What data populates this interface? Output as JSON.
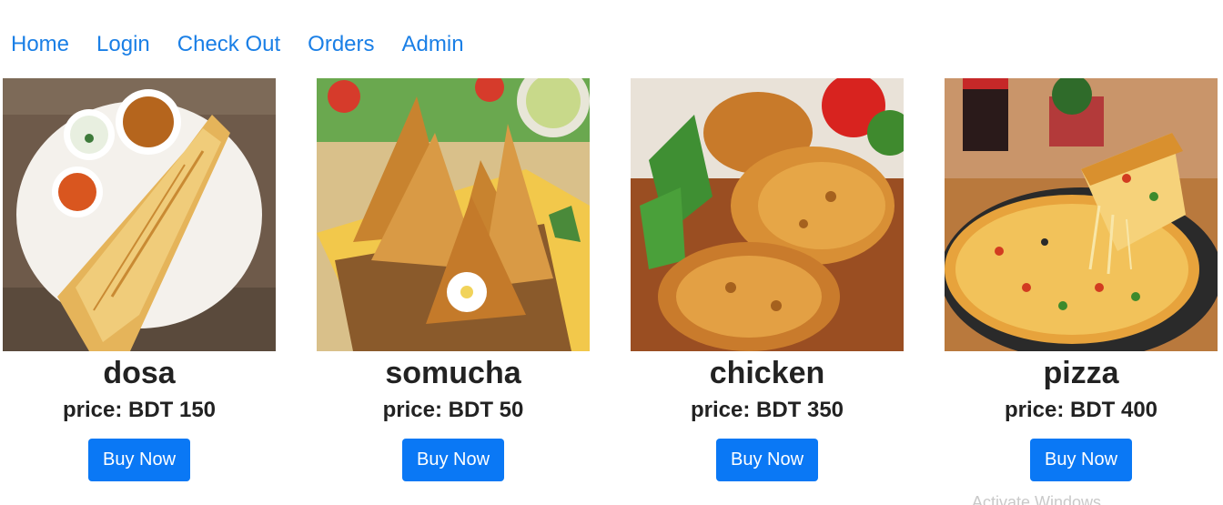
{
  "nav": {
    "items": [
      {
        "label": "Home"
      },
      {
        "label": "Login"
      },
      {
        "label": "Check Out"
      },
      {
        "label": "Orders"
      },
      {
        "label": "Admin"
      }
    ]
  },
  "products": [
    {
      "name": "dosa",
      "price": "price: BDT 150",
      "button": "Buy Now",
      "image": "dosa-photo"
    },
    {
      "name": "somucha",
      "price": "price: BDT 50",
      "button": "Buy Now",
      "image": "samosa-photo"
    },
    {
      "name": "chicken",
      "price": "price: BDT 350",
      "button": "Buy Now",
      "image": "fried-chicken-photo"
    },
    {
      "name": "pizza",
      "price": "price: BDT 400",
      "button": "Buy Now",
      "image": "pizza-photo"
    }
  ],
  "colors": {
    "link": "#1a7fe6",
    "button": "#0a78f5"
  },
  "watermark": "Activate Windows"
}
